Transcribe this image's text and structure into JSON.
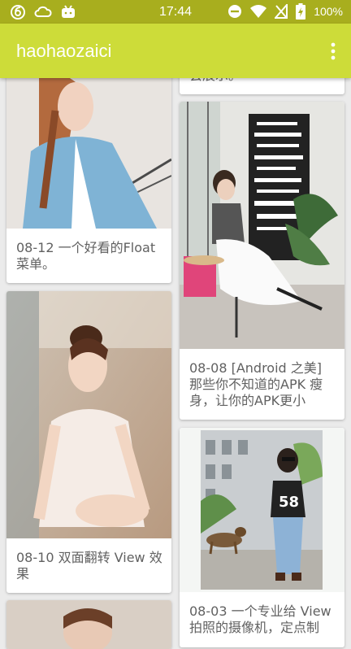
{
  "status_bar": {
    "time": "17:44",
    "battery": "100%",
    "icons": [
      "app-notification-icon",
      "cloud-icon",
      "bilibili-icon",
      "do-not-disturb-icon",
      "wifi-icon",
      "no-sim-icon",
      "battery-charging-icon"
    ]
  },
  "app_bar": {
    "title": "haohaozaici",
    "menu_icon": "more-vert-icon"
  },
  "colors": {
    "status_bar": "#a8ae1e",
    "app_bar": "#cddc39",
    "background": "#ebebeb",
    "caption_text": "#616161"
  },
  "feed": {
    "left": [
      {
        "caption": "08-12 一个好看的Float 菜单。",
        "photo": "girl-denim-jacket-photo"
      },
      {
        "caption": "08-10 双面翻转 View 效果",
        "photo": "girl-sitting-ballet-photo"
      },
      {
        "caption": "",
        "photo": "portrait-photo"
      }
    ],
    "right": [
      {
        "caption": "会展示。",
        "photo": ""
      },
      {
        "caption": "08-08 [Android 之美] 那些你不知道的APK 瘦身，让你的APK更小",
        "photo": "girl-station-sign-photo"
      },
      {
        "caption": "08-03 一个专业给 View 拍照的摄像机，定点制",
        "photo": "girl-street-dog-photo"
      }
    ]
  }
}
